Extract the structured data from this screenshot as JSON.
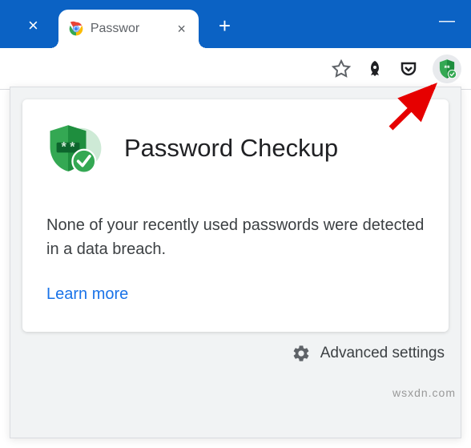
{
  "browser": {
    "tab": {
      "title": "Passwor",
      "close_x": "×"
    },
    "prev_tab_close": "×",
    "new_tab": "+",
    "minimize": "—"
  },
  "toolbar": {
    "star_icon": "star",
    "rocket_icon": "rocket",
    "pocket_icon": "pocket",
    "extension_icon": "password-checkup"
  },
  "popup": {
    "title": "Password Checkup",
    "body": "None of your recently used passwords were detected in a data breach.",
    "learn_more": "Learn more",
    "advanced_settings": "Advanced settings"
  },
  "watermark": "wsxdn.com"
}
